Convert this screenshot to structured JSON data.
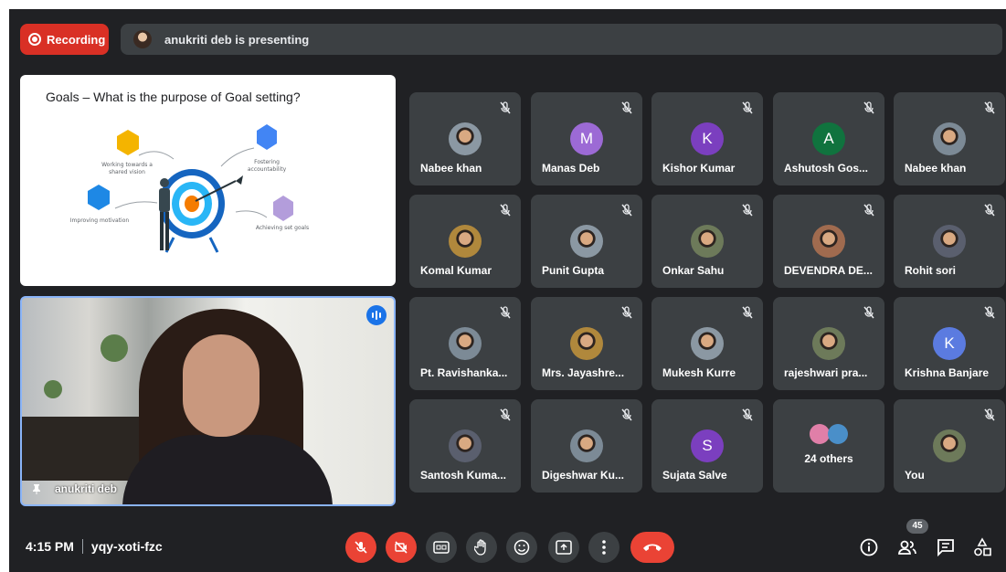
{
  "top_bar": {
    "recording_label": "Recording",
    "presenting_text": "anukriti deb is presenting"
  },
  "slide": {
    "title": "Goals – What is the purpose of Goal setting?",
    "labels": {
      "shared_vision": "Working towards a shared vision",
      "accountability": "Fostering accountability",
      "motivation": "Improving motivation",
      "achieving": "Achieving set goals"
    }
  },
  "presenter": {
    "name": "anukriti deb"
  },
  "participants": [
    {
      "name": "Nabee khan",
      "avatar": "photo"
    },
    {
      "name": "Manas Deb",
      "avatar": "M",
      "color": "#9c6ad5"
    },
    {
      "name": "Kishor Kumar",
      "avatar": "K",
      "color": "#7b3fbf"
    },
    {
      "name": "Ashutosh Gos...",
      "avatar": "A",
      "color": "#10733e"
    },
    {
      "name": "Nabee khan",
      "avatar": "photo"
    },
    {
      "name": "Komal Kumar",
      "avatar": "photo"
    },
    {
      "name": "Punit Gupta",
      "avatar": "photo"
    },
    {
      "name": "Onkar Sahu",
      "avatar": "photo"
    },
    {
      "name": "DEVENDRA DE...",
      "avatar": "photo"
    },
    {
      "name": "Rohit sori",
      "avatar": "photo"
    },
    {
      "name": "Pt. Ravishanka...",
      "avatar": "photo"
    },
    {
      "name": "Mrs. Jayashre...",
      "avatar": "photo"
    },
    {
      "name": "Mukesh Kurre",
      "avatar": "photo"
    },
    {
      "name": "rajeshwari pra...",
      "avatar": "photo"
    },
    {
      "name": "Krishna Banjare",
      "avatar": "K",
      "color": "#5b7be0"
    },
    {
      "name": "Santosh Kuma...",
      "avatar": "photo"
    },
    {
      "name": "Digeshwar Ku...",
      "avatar": "photo"
    },
    {
      "name": "Sujata Salve",
      "avatar": "S",
      "color": "#7b3fbf"
    },
    {
      "name": "24 others",
      "avatar": "group"
    },
    {
      "name": "You",
      "avatar": "photo"
    }
  ],
  "bottom_bar": {
    "time": "4:15 PM",
    "meeting_code": "yqy-xoti-fzc",
    "participant_count": "45"
  },
  "colors": {
    "accent_red": "#ea4335",
    "panel": "#3c4043",
    "background": "#202124",
    "speaking_blue": "#1a73e8"
  }
}
